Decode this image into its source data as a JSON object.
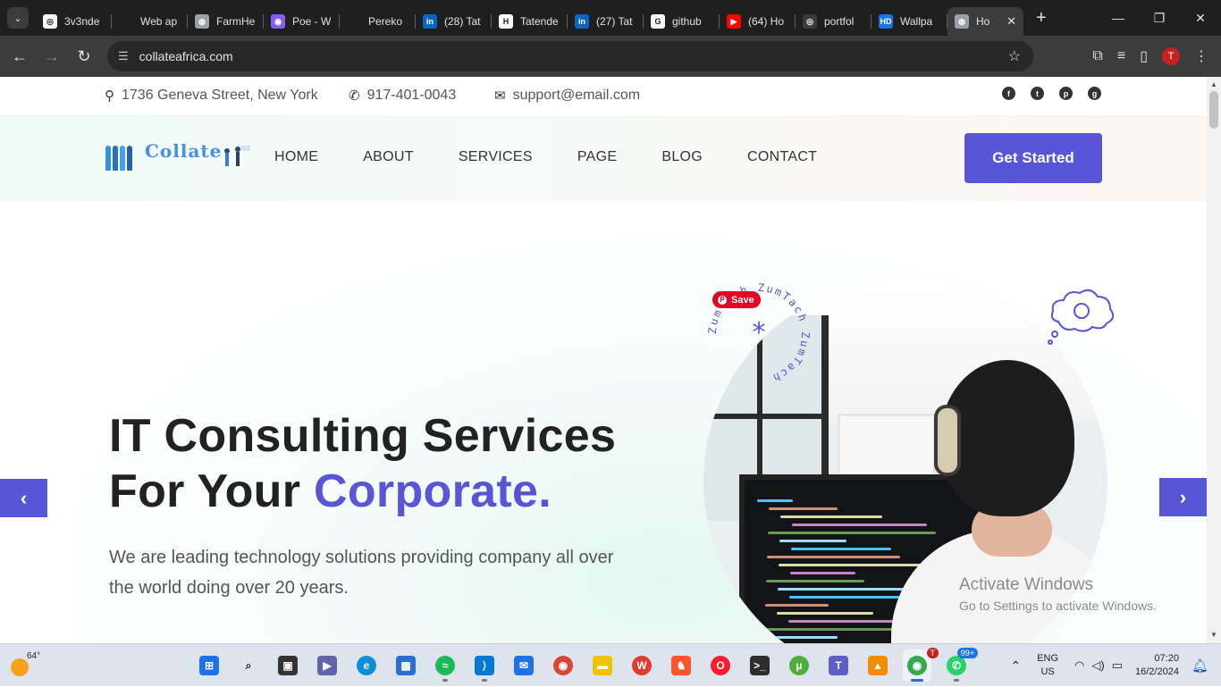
{
  "browser": {
    "tabs": [
      {
        "title": "3v3nde",
        "favicon": "github-icon",
        "color": "#ffffff",
        "active": false
      },
      {
        "title": "Web ap",
        "favicon": "web-icon",
        "color": "#1f1f1f",
        "active": false
      },
      {
        "title": "FarmHe",
        "favicon": "globe-icon",
        "color": "#9aa0a6",
        "active": false
      },
      {
        "title": "Poe - W",
        "favicon": "poe-icon",
        "color": "#8a5cf6",
        "active": false
      },
      {
        "title": "Pereko",
        "favicon": "page-icon",
        "color": "#1f1f1f",
        "active": false
      },
      {
        "title": "(28) Tat",
        "favicon": "linkedin-icon",
        "color": "#0a66c2",
        "active": false
      },
      {
        "title": "Tatende",
        "favicon": "hashnode-icon",
        "color": "#ffffff",
        "active": false
      },
      {
        "title": "(27) Tat",
        "favicon": "linkedin-icon",
        "color": "#0a66c2",
        "active": false
      },
      {
        "title": "github",
        "favicon": "google-icon",
        "color": "#ffffff",
        "active": false
      },
      {
        "title": "(64) Ho",
        "favicon": "youtube-icon",
        "color": "#ff0000",
        "active": false
      },
      {
        "title": "portfol",
        "favicon": "github-icon",
        "color": "#3c3c3c",
        "active": false
      },
      {
        "title": "Wallpa",
        "favicon": "hd-icon",
        "color": "#1a73e8",
        "active": false
      },
      {
        "title": "Ho",
        "favicon": "globe-icon",
        "color": "#9aa0a6",
        "active": true
      }
    ],
    "url": "collateafrica.com",
    "profile_initial": "T"
  },
  "topbar": {
    "address": "1736 Geneva Street, New York",
    "phone": "917-401-0043",
    "email": "support@email.com",
    "socials": [
      "facebook-icon",
      "twitter-icon",
      "pinterest-icon",
      "github-icon"
    ]
  },
  "header": {
    "logo_text": "Collate",
    "nav": [
      "HOME",
      "ABOUT",
      "SERVICES",
      "PAGE",
      "BLOG",
      "CONTACT"
    ],
    "cta": "Get Started"
  },
  "hero": {
    "title_line1": "IT Consulting Services",
    "title_line2_prefix": "For Your ",
    "title_accent": "Corporate.",
    "subtitle": "We are leading technology solutions providing company all over the world doing over 20 years.",
    "badge_text": "ZumTach ZumTach ZumTach",
    "save_label": "Save"
  },
  "watermark": {
    "line1": "Activate Windows",
    "line2": "Go to Settings to activate Windows."
  },
  "taskbar": {
    "temperature": "64°",
    "lang_line1": "ENG",
    "lang_line2": "US",
    "time": "07:20",
    "date": "16/2/2024",
    "whatsapp_badge": "99+",
    "chrome_badge": "T",
    "accent": "#5856d6"
  }
}
